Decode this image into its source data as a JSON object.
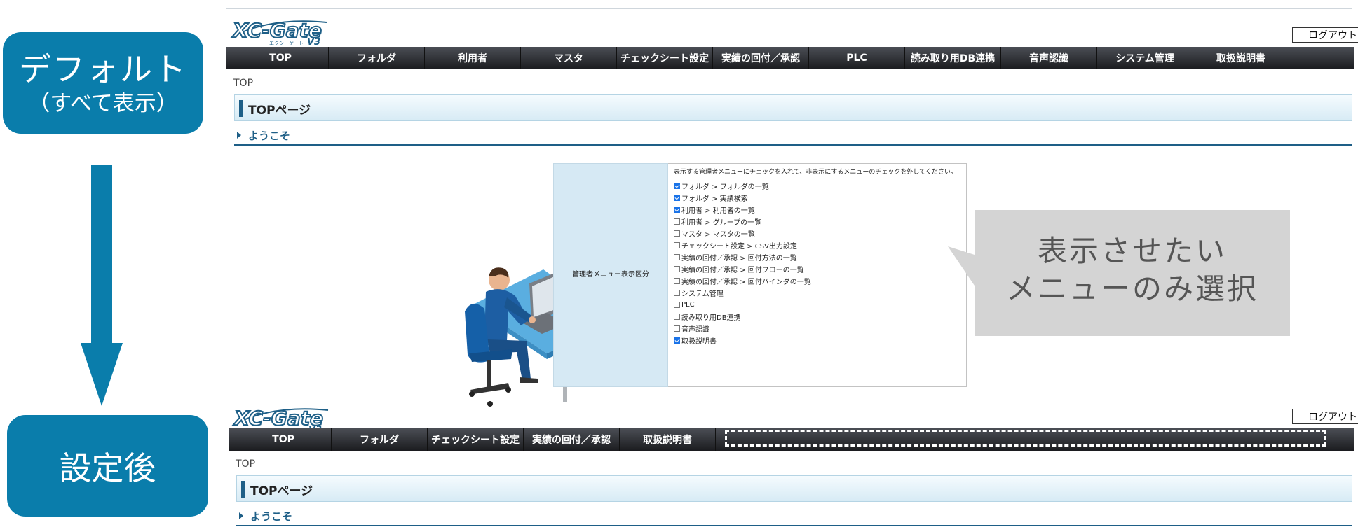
{
  "labels": {
    "default_line1": "デフォルト",
    "default_line2": "（すべて表示）",
    "after": "設定後"
  },
  "logo": {
    "main": "XC-Gate",
    "sub": "エクシーゲート",
    "version": "V3"
  },
  "logout": "ログアウト",
  "nav_default": [
    "TOP",
    "フォルダ",
    "利用者",
    "マスタ",
    "チェックシート設定",
    "実績の回付／承認",
    "PLC",
    "読み取り用DB連携",
    "音声認識",
    "システム管理",
    "取扱説明書"
  ],
  "nav_after": [
    "TOP",
    "フォルダ",
    "チェックシート設定",
    "実績の回付／承認",
    "取扱説明書"
  ],
  "breadcrumb": "TOP",
  "page_title": "TOPページ",
  "section": "ようこそ",
  "settings": {
    "side_label": "管理者メニュー表示区分",
    "instruction": "表示する管理者メニューにチェックを入れて、非表示にするメニューのチェックを外してください。",
    "options": [
      {
        "label": "フォルダ > フォルダの一覧",
        "checked": true
      },
      {
        "label": "フォルダ > 実績検索",
        "checked": true
      },
      {
        "label": "利用者 > 利用者の一覧",
        "checked": true
      },
      {
        "label": "利用者 > グループの一覧",
        "checked": false
      },
      {
        "label": "マスタ > マスタの一覧",
        "checked": false
      },
      {
        "label": "チェックシート設定 > CSV出力設定",
        "checked": false
      },
      {
        "label": "実績の回付／承認 > 回付方法の一覧",
        "checked": false
      },
      {
        "label": "実績の回付／承認 > 回付フローの一覧",
        "checked": false
      },
      {
        "label": "実績の回付／承認 > 回付バインダの一覧",
        "checked": false
      },
      {
        "label": "システム管理",
        "checked": false
      },
      {
        "label": "PLC",
        "checked": false
      },
      {
        "label": "読み取り用DB連携",
        "checked": false
      },
      {
        "label": "音声認識",
        "checked": false
      },
      {
        "label": "取扱説明書",
        "checked": true
      }
    ]
  },
  "callout": {
    "line1": "表示させたい",
    "line2": "メニューのみ選択"
  },
  "colors": {
    "accent": "#0a7dab",
    "navy": "#1e5f87",
    "callout": "#d4d4d4"
  }
}
